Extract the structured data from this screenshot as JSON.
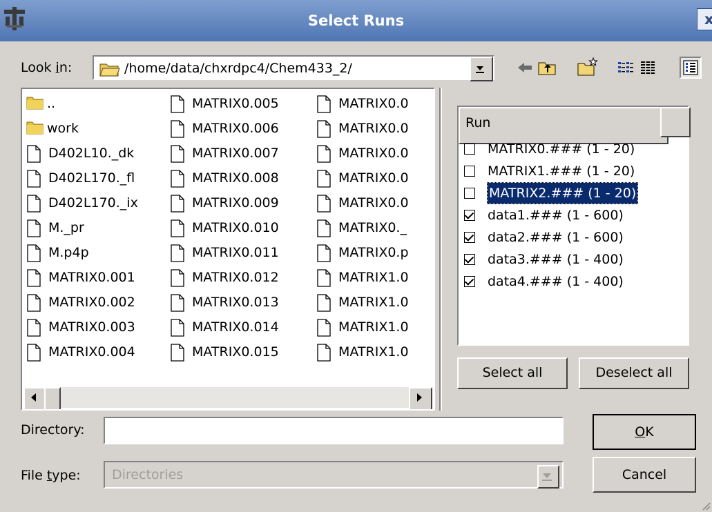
{
  "window": {
    "title": "Select Runs",
    "close_label": "x"
  },
  "look_in": {
    "label_pre": "Look ",
    "label_u": "i",
    "label_post": "n:",
    "path": "/home/data/chxrdpc4/Chem433_2/"
  },
  "toolbar": [
    "back-icon",
    "parent-folder-icon",
    "new-folder-icon",
    "list-view-icon",
    "detail-view-icon",
    "preview-icon"
  ],
  "files": {
    "col1": [
      "..",
      "work",
      "D402L10._dk",
      "D402L170._fl",
      "D402L170._ix",
      "M._pr",
      "M.p4p",
      "MATRIX0.001",
      "MATRIX0.002",
      "MATRIX0.003",
      "MATRIX0.004"
    ],
    "col2": [
      "MATRIX0.005",
      "MATRIX0.006",
      "MATRIX0.007",
      "MATRIX0.008",
      "MATRIX0.009",
      "MATRIX0.010",
      "MATRIX0.011",
      "MATRIX0.012",
      "MATRIX0.013",
      "MATRIX0.014",
      "MATRIX0.015"
    ],
    "col3": [
      "MATRIX0.0",
      "MATRIX0.0",
      "MATRIX0.0",
      "MATRIX0.0",
      "MATRIX0.0",
      "MATRIX0._",
      "MATRIX0.p",
      "MATRIX1.0",
      "MATRIX1.0",
      "MATRIX1.0",
      "MATRIX1.0"
    ],
    "folders": [
      "..",
      "work"
    ]
  },
  "runs": {
    "header": "Run",
    "items": [
      {
        "label": "MATRIX0.### (1 - 20)",
        "checked": false,
        "selected": false
      },
      {
        "label": "MATRIX1.### (1 - 20)",
        "checked": false,
        "selected": false
      },
      {
        "label": "MATRIX2.### (1 - 20)",
        "checked": false,
        "selected": true
      },
      {
        "label": "data1.### (1 - 600)",
        "checked": true,
        "selected": false
      },
      {
        "label": "data2.### (1 - 600)",
        "checked": true,
        "selected": false
      },
      {
        "label": "data3.### (1 - 400)",
        "checked": true,
        "selected": false
      },
      {
        "label": "data4.### (1 - 400)",
        "checked": true,
        "selected": false
      }
    ],
    "select_all": "Select all",
    "deselect_all": "Deselect all"
  },
  "directory": {
    "label": "Directory:",
    "value": ""
  },
  "file_type": {
    "label_pre": "File ",
    "label_u": "t",
    "label_post": "ype:",
    "value": "Directories"
  },
  "buttons": {
    "ok_u": "O",
    "ok_rest": "K",
    "cancel": "Cancel"
  }
}
